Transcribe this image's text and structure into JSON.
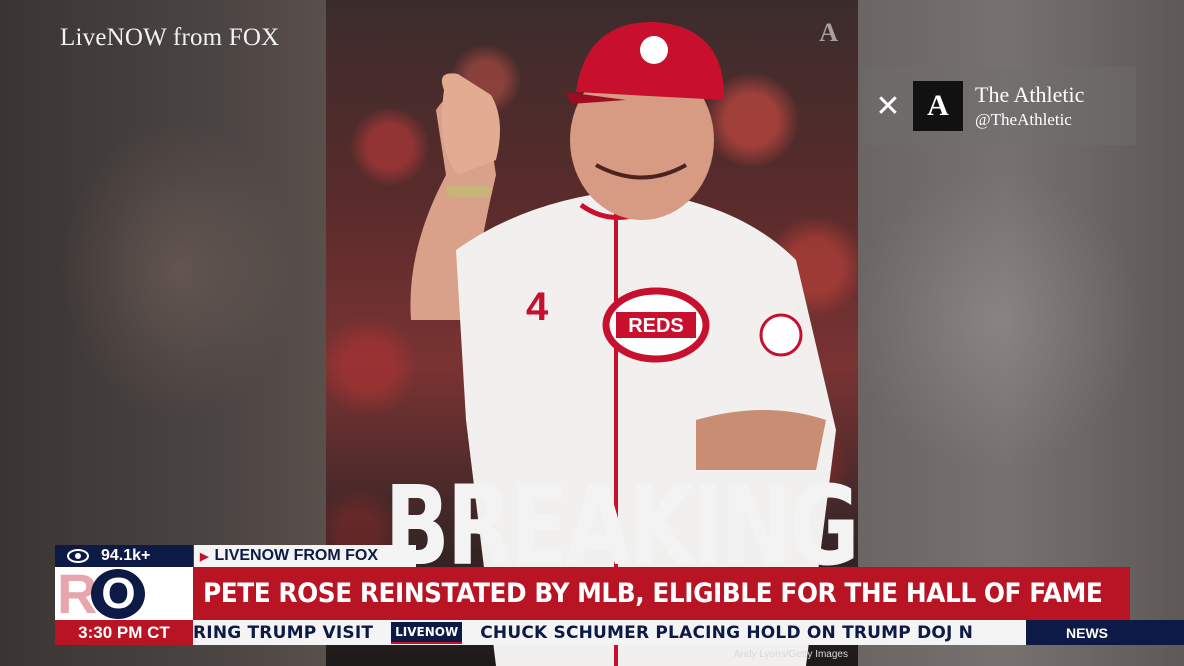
{
  "broadcast": {
    "source_label": "LiveNOW from FOX",
    "photo_headline": "BREAKING",
    "photo_watermark": "A",
    "photo_credit": "Andy Lyons/Getty Images",
    "tweet": {
      "platform_icon": "x-icon",
      "logo_letter": "A",
      "name": "The Athletic",
      "handle": "@TheAthletic"
    }
  },
  "lower_third": {
    "viewers": "94.1k+",
    "source": "LIVENOW FROM FOX",
    "logo_letters": [
      "R",
      "O"
    ],
    "headline": "PETE ROSE REINSTATED BY MLB, ELIGIBLE FOR THE HALL OF FAME",
    "time": "3:30 PM CT",
    "ticker_left": "RING TRUMP VISIT",
    "ticker_logo": "LIVENOW",
    "ticker_right": "CHUCK SCHUMER PLACING HOLD ON TRUMP DOJ N",
    "section": "NEWS"
  },
  "colors": {
    "navy": "#0d1a45",
    "red": "#b81423",
    "white": "#f4f4f4"
  }
}
